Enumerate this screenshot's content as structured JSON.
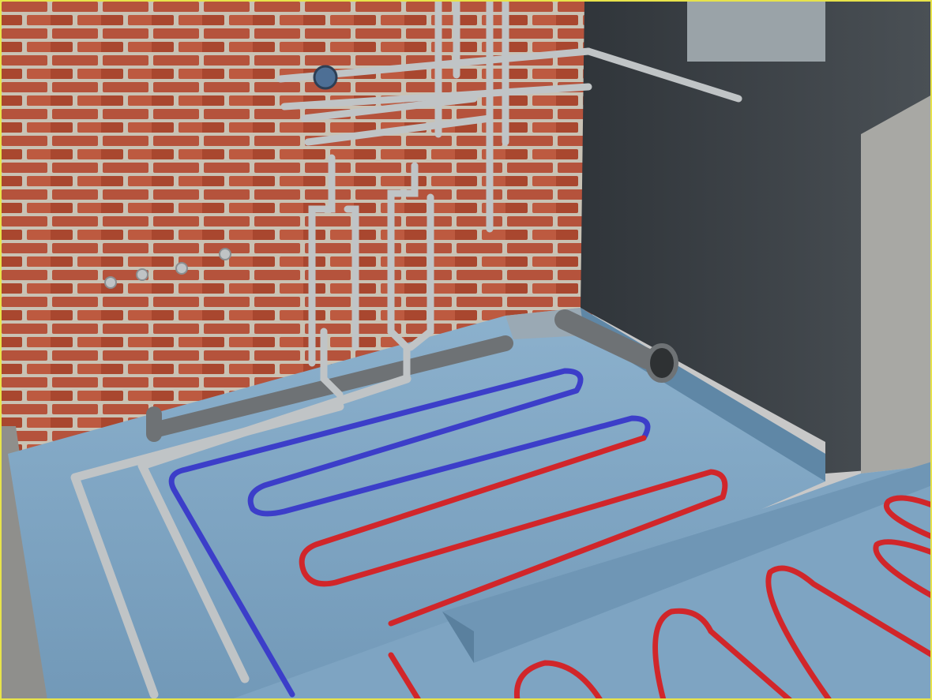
{
  "scene": {
    "subject": "plumbing-and-underfloor-heating-render",
    "colors": {
      "brick": "#b5533c",
      "mortar": "#c9c2b4",
      "concrete_dark": "#3f4448",
      "concrete_light": "#a8a8a4",
      "floor": "#7fa6c4",
      "floor_edge": "#5f87a6",
      "pipe_supply": "#c0c4c6",
      "pipe_sewer": "#6e7275",
      "heating_hot": "#d1262a",
      "heating_cold": "#3c3ec9",
      "frame": "#e7e34a"
    },
    "objects": [
      "brick-wall",
      "concrete-column",
      "floor-slab",
      "lower-floor-slab",
      "water-riser-pipes",
      "water-meter",
      "wall-taps",
      "sewer-pipe",
      "sewer-elbow",
      "floor-supply-pipes",
      "heating-loop-cold",
      "heating-loop-hot",
      "lower-heating-loop"
    ]
  }
}
